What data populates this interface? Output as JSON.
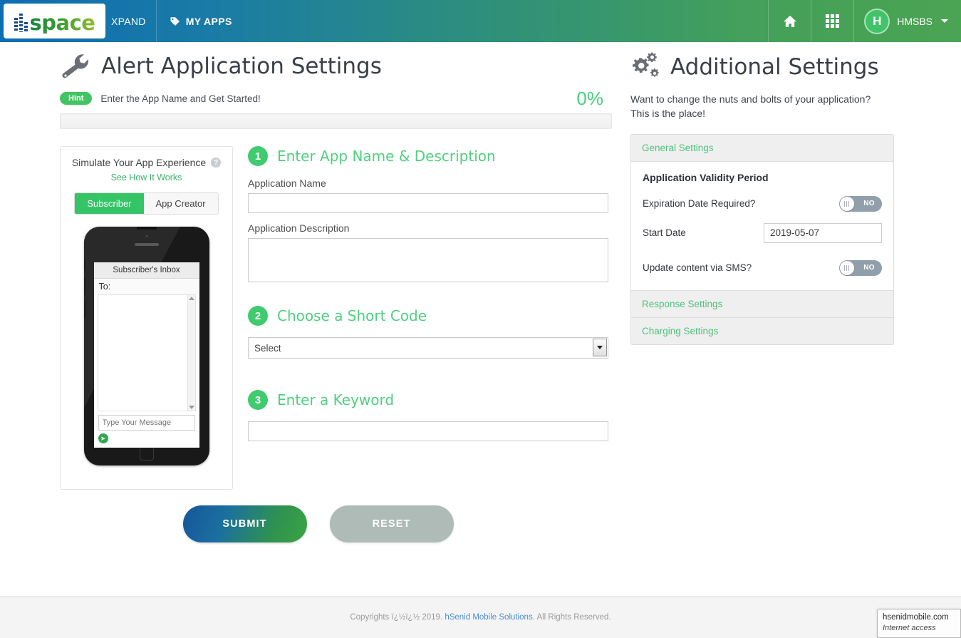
{
  "header": {
    "logo_text": "space",
    "logo_suffix": "XPAND",
    "my_apps_label": "MY APPS",
    "my_apps_icon": "tag-icon",
    "home_icon": "home-icon",
    "apps_grid_icon": "grid-icon",
    "avatar_initial": "H",
    "user_name": "HMSBS",
    "gradient_from": "#0d6db2",
    "gradient_to": "#4ba453"
  },
  "main": {
    "title": "Alert Application Settings",
    "title_icon": "wrench-icon",
    "hint_badge": "Hint",
    "hint_text": "Enter the App Name and Get Started!",
    "progress_percent": "0%",
    "progress_value": 0
  },
  "simulator": {
    "title": "Simulate Your App Experience",
    "help_icon": "question-mark-icon",
    "link": "See How It Works",
    "tabs": [
      {
        "label": "Subscriber",
        "active": true
      },
      {
        "label": "App Creator",
        "active": false
      }
    ],
    "phone": {
      "screen_title": "Subscriber's Inbox",
      "to_label": "To:",
      "message_placeholder": "Type Your Message",
      "send_icon": "send-arrow-icon"
    }
  },
  "form": {
    "steps": [
      {
        "number": "1",
        "title": "Enter App Name & Description"
      },
      {
        "number": "2",
        "title": "Choose a Short Code"
      },
      {
        "number": "3",
        "title": "Enter a Keyword"
      }
    ],
    "app_name_label": "Application Name",
    "app_name_value": "",
    "app_desc_label": "Application Description",
    "app_desc_value": "",
    "shortcode_selected": "Select",
    "keyword_value": "",
    "submit_label": "SUBMIT",
    "reset_label": "RESET"
  },
  "additional": {
    "title": "Additional Settings",
    "title_icon": "gears-icon",
    "description": "Want to change the nuts and bolts of your application? This is the place!",
    "sections": [
      {
        "label": "General Settings",
        "expanded": true
      },
      {
        "label": "Response Settings",
        "expanded": false
      },
      {
        "label": "Charging Settings",
        "expanded": false
      }
    ],
    "general": {
      "subheading": "Application Validity Period",
      "expiration_label": "Expiration Date Required?",
      "expiration_toggle": "NO",
      "start_date_label": "Start Date",
      "start_date_value": "2019-05-07",
      "sms_update_label": "Update content via SMS?",
      "sms_update_toggle": "NO"
    }
  },
  "footer": {
    "copyright_prefix": "Copyrights ï¿½ï¿½ 2019.",
    "company_link": "hSenid Mobile Solutions",
    "copyright_suffix": ". All Rights Reserved.",
    "tooltip_domain": "hsenidmobile.com",
    "tooltip_status": "Internet access"
  }
}
